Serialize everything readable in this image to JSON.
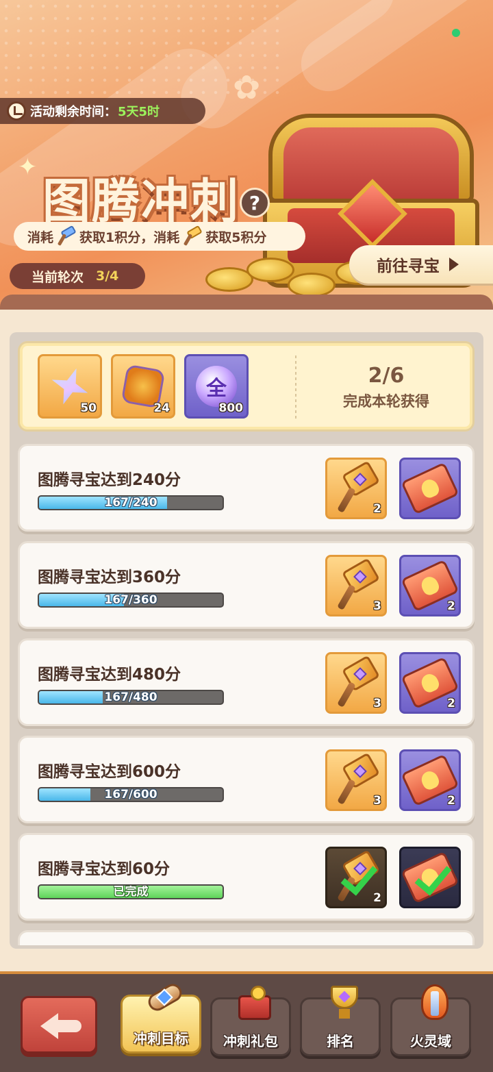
{
  "header": {
    "timer_label": "活动剩余时间：",
    "timer_value": "5天5时",
    "title": "图腾冲刺",
    "help_symbol": "?",
    "rule_part1": "消耗",
    "rule_part2": "获取1积分，消耗",
    "rule_part3": "获取5积分",
    "round_label": "当前轮次",
    "round_value": "3/4",
    "treasure_button": "前往寻宝"
  },
  "round_reward": {
    "items": [
      {
        "icon": "crystal-icon",
        "count": "50"
      },
      {
        "icon": "stone-icon",
        "count": "24"
      },
      {
        "icon": "orb-icon",
        "glyph": "全",
        "count": "800"
      }
    ],
    "progress": "2/6",
    "label": "完成本轮获得"
  },
  "tasks": [
    {
      "title": "图腾寻宝达到240分",
      "progress_text": "167/240",
      "progress": 0.696,
      "hammer_count": "2",
      "ticket_count": "",
      "completed": false
    },
    {
      "title": "图腾寻宝达到360分",
      "progress_text": "167/360",
      "progress": 0.464,
      "hammer_count": "3",
      "ticket_count": "2",
      "completed": false
    },
    {
      "title": "图腾寻宝达到480分",
      "progress_text": "167/480",
      "progress": 0.348,
      "hammer_count": "3",
      "ticket_count": "2",
      "completed": false
    },
    {
      "title": "图腾寻宝达到600分",
      "progress_text": "167/600",
      "progress": 0.278,
      "hammer_count": "3",
      "ticket_count": "2",
      "completed": false
    },
    {
      "title": "图腾寻宝达到60分",
      "progress_text": "已完成",
      "progress": 1.0,
      "hammer_count": "2",
      "ticket_count": "",
      "completed": true
    }
  ],
  "nav": {
    "tabs": [
      {
        "label": "冲刺目标",
        "icon": "scroll-icon",
        "active": true
      },
      {
        "label": "冲刺礼包",
        "icon": "gift-icon",
        "active": false
      },
      {
        "label": "排名",
        "icon": "trophy-icon",
        "active": false
      },
      {
        "label": "火灵域",
        "icon": "fire-icon",
        "active": false
      }
    ]
  },
  "colors": {
    "accent": "#f19158",
    "progress_blue": "#4ab7e9",
    "progress_green": "#5ed45a",
    "timer_value": "#9cf25c"
  }
}
